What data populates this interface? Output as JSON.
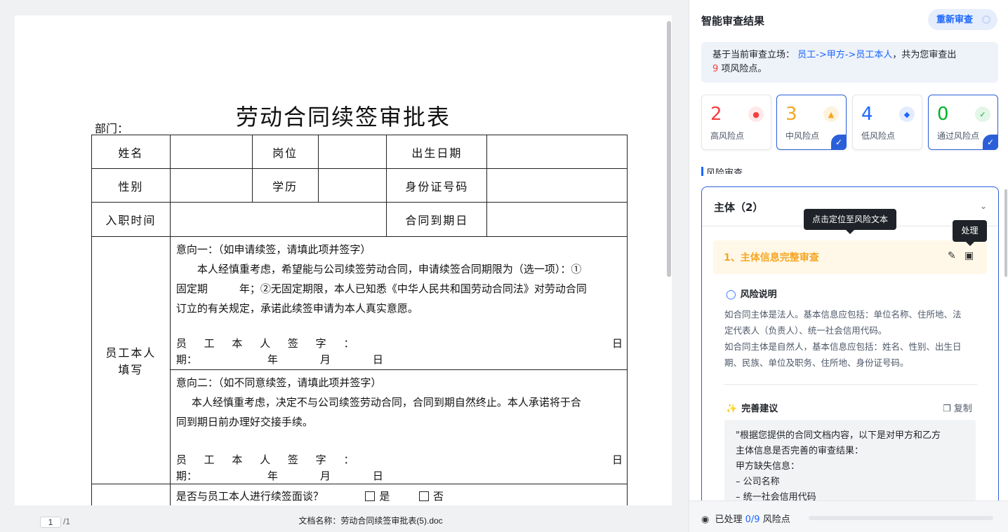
{
  "document": {
    "title": "劳动合同续签审批表",
    "dept_label": "部门：",
    "rows": {
      "name": "姓名",
      "position": "岗位",
      "birth_date": "出生日期",
      "gender": "性别",
      "education": "学历",
      "id_number": "身份证号码",
      "entry_time": "入职时间",
      "contract_expiry": "合同到期日",
      "employee_fill_line1": "员工本人",
      "employee_fill_line2": "填写"
    },
    "intent1": {
      "heading": "意向一：（如申请续签，请填此项并签字）",
      "body_line1": "本人经慎重考虑，希望能与公司续签劳动合同，申请续签合同期限为（选一项）：①",
      "body_line2": "固定期　　　年；②无固定期限，本人已知悉《中华人民共和国劳动合同法》对劳动合同",
      "body_line3": "订立的有关规定，承诺此续签申请为本人真实意愿。",
      "sign_label": "员 工 本 人 签 字 ：",
      "day_label": "日",
      "date_prefix": "期：",
      "year": "年",
      "month": "月",
      "day": "日"
    },
    "intent2": {
      "heading": "意向二：（如不同意续签，请填此项并签字）",
      "body_line1": "本人经慎重考虑，决定不与公司续签劳动合同，合同到期自然终止。本人承诺将于合",
      "body_line2": "同到期日前办理好交接手续。",
      "sign_label": "员 工 本 人 签 字 ：",
      "day_label": "日",
      "date_prefix": "期：",
      "year": "年",
      "month": "月",
      "day": "日"
    },
    "interview": {
      "question": "是否与员工本人进行续签面谈？",
      "yes": "是",
      "no": "否"
    }
  },
  "viewer_footer": {
    "page_current": "1",
    "page_total": "/1",
    "doc_name": "文档名称：劳动合同续签审批表(5).doc"
  },
  "panel": {
    "title": "智能审查结果",
    "recheck_label": "重新审查",
    "summary": {
      "prefix": "基于当前审查立场：",
      "stance": "员工->甲方->员工本人",
      "middle": "，共为您审查出",
      "count": "9",
      "suffix": "项风险点。"
    },
    "stats": [
      {
        "value": "2",
        "label": "高风险点",
        "color": "#f53f3f",
        "icon": "flame-icon",
        "selected": false
      },
      {
        "value": "3",
        "label": "中风险点",
        "color": "#f5a623",
        "icon": "shield-warning-icon",
        "selected": true
      },
      {
        "value": "4",
        "label": "低风险点",
        "color": "#1a66ff",
        "icon": "drop-icon",
        "selected": false
      },
      {
        "value": "0",
        "label": "通过风险点",
        "color": "#00b42a",
        "icon": "check-circle-icon",
        "selected": true
      }
    ],
    "section_label": "风险审查",
    "subject": {
      "header": "主体（2）",
      "risk_item_title": "1、主体信息完整审查",
      "tooltip_locate": "点击定位至风险文本",
      "tooltip_handle": "处理",
      "explain_heading": "风险说明",
      "explain_lines": [
        "如合同主体是法人。基本信息应包括：单位名称、住所地、法",
        "定代表人（负责人）、统一社会信用代码。",
        "如合同主体是自然人，基本信息应包括：姓名、性别、出生日",
        "期、民族、单位及职务、住所地、身份证号码。"
      ],
      "suggest_heading": "完善建议",
      "copy_label": "复制",
      "suggest_lines": [
        "\"根据您提供的合同文档内容，以下是对甲方和乙方",
        "主体信息是否完善的审查结果：",
        "甲方缺失信息：",
        "– 公司名称",
        "– 统一社会信用代码"
      ]
    },
    "footer": {
      "processed_prefix": "已处理",
      "processed_count": "0/9",
      "processed_suffix": "风险点",
      "progress_fraction": 0
    }
  }
}
